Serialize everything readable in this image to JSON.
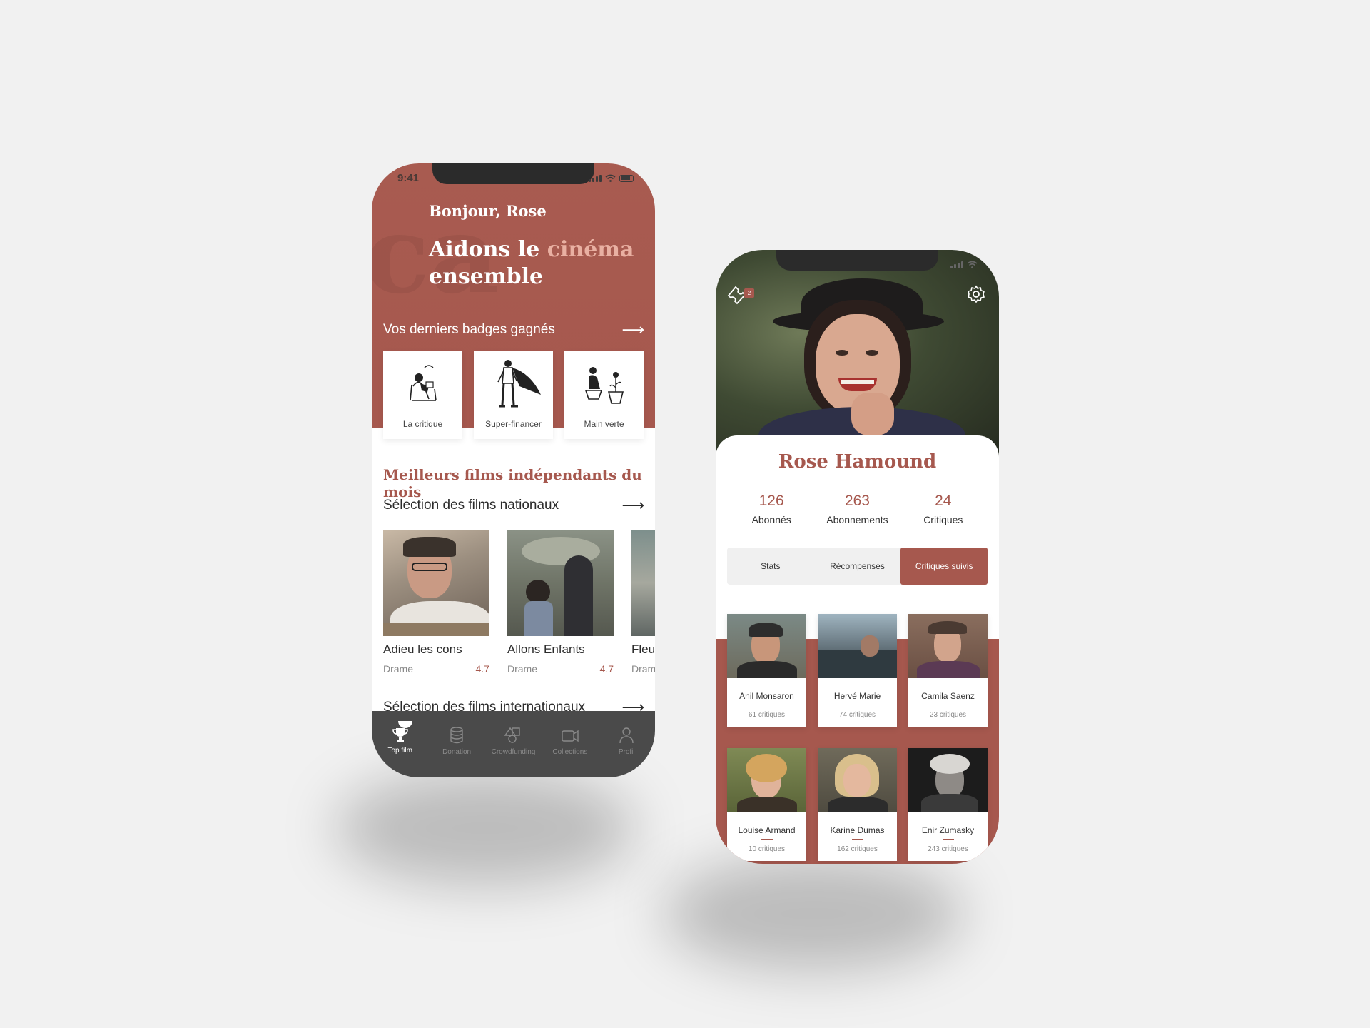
{
  "colors": {
    "accent": "#a6584e",
    "accent_light": "#e9b0a2",
    "tabbar": "#4a4a4a",
    "background": "#f1f1f1"
  },
  "status": {
    "time": "9:41"
  },
  "home": {
    "greeting": "Bonjour, Rose",
    "headline_part1": "Aidons le ",
    "headline_accent": "cinéma",
    "headline_part2": "ensemble",
    "badges_title": "Vos derniers badges gagnés",
    "badges": [
      {
        "label": "La critique",
        "icon": "reading-person-icon"
      },
      {
        "label": "Super-financer",
        "icon": "caped-hero-icon"
      },
      {
        "label": "Main verte",
        "icon": "gardener-icon"
      }
    ],
    "best_title": "Meilleurs films indépendants du mois",
    "national_title": "Sélection des films nationaux",
    "films": [
      {
        "title": "Adieu les cons",
        "genre": "Drame",
        "rating": "4.7"
      },
      {
        "title": "Allons Enfants",
        "genre": "Drame",
        "rating": "4.7"
      },
      {
        "title": "Fleu",
        "genre": "Dram",
        "rating": ""
      }
    ],
    "international_title": "Sélection des films internationaux",
    "tabs": [
      {
        "label": "Top film",
        "icon": "trophy-icon",
        "active": true
      },
      {
        "label": "Donation",
        "icon": "coins-icon",
        "active": false
      },
      {
        "label": "Crowdfunding",
        "icon": "shapes-icon",
        "active": false
      },
      {
        "label": "Collections",
        "icon": "video-camera-icon",
        "active": false
      },
      {
        "label": "Profil",
        "icon": "user-icon",
        "active": false
      }
    ]
  },
  "profile": {
    "notification_count": "2",
    "name": "Rose Hamound",
    "stats": [
      {
        "value": "126",
        "label": "Abonnés"
      },
      {
        "value": "263",
        "label": "Abonnements"
      },
      {
        "value": "24",
        "label": "Critiques"
      }
    ],
    "segments": [
      "Stats",
      "Récompenses",
      "Critiques suivis"
    ],
    "active_segment": "Critiques suivis",
    "critics": [
      {
        "name": "Anil Monsaron",
        "count": "61 critiques"
      },
      {
        "name": "Hervé Marie",
        "count": "74 critiques"
      },
      {
        "name": "Camila Saenz",
        "count": "23 critiques"
      },
      {
        "name": "Louise Armand",
        "count": "10 critiques"
      },
      {
        "name": "Karine Dumas",
        "count": "162 critiques"
      },
      {
        "name": "Enir Zumasky",
        "count": "243 critiques"
      }
    ]
  }
}
